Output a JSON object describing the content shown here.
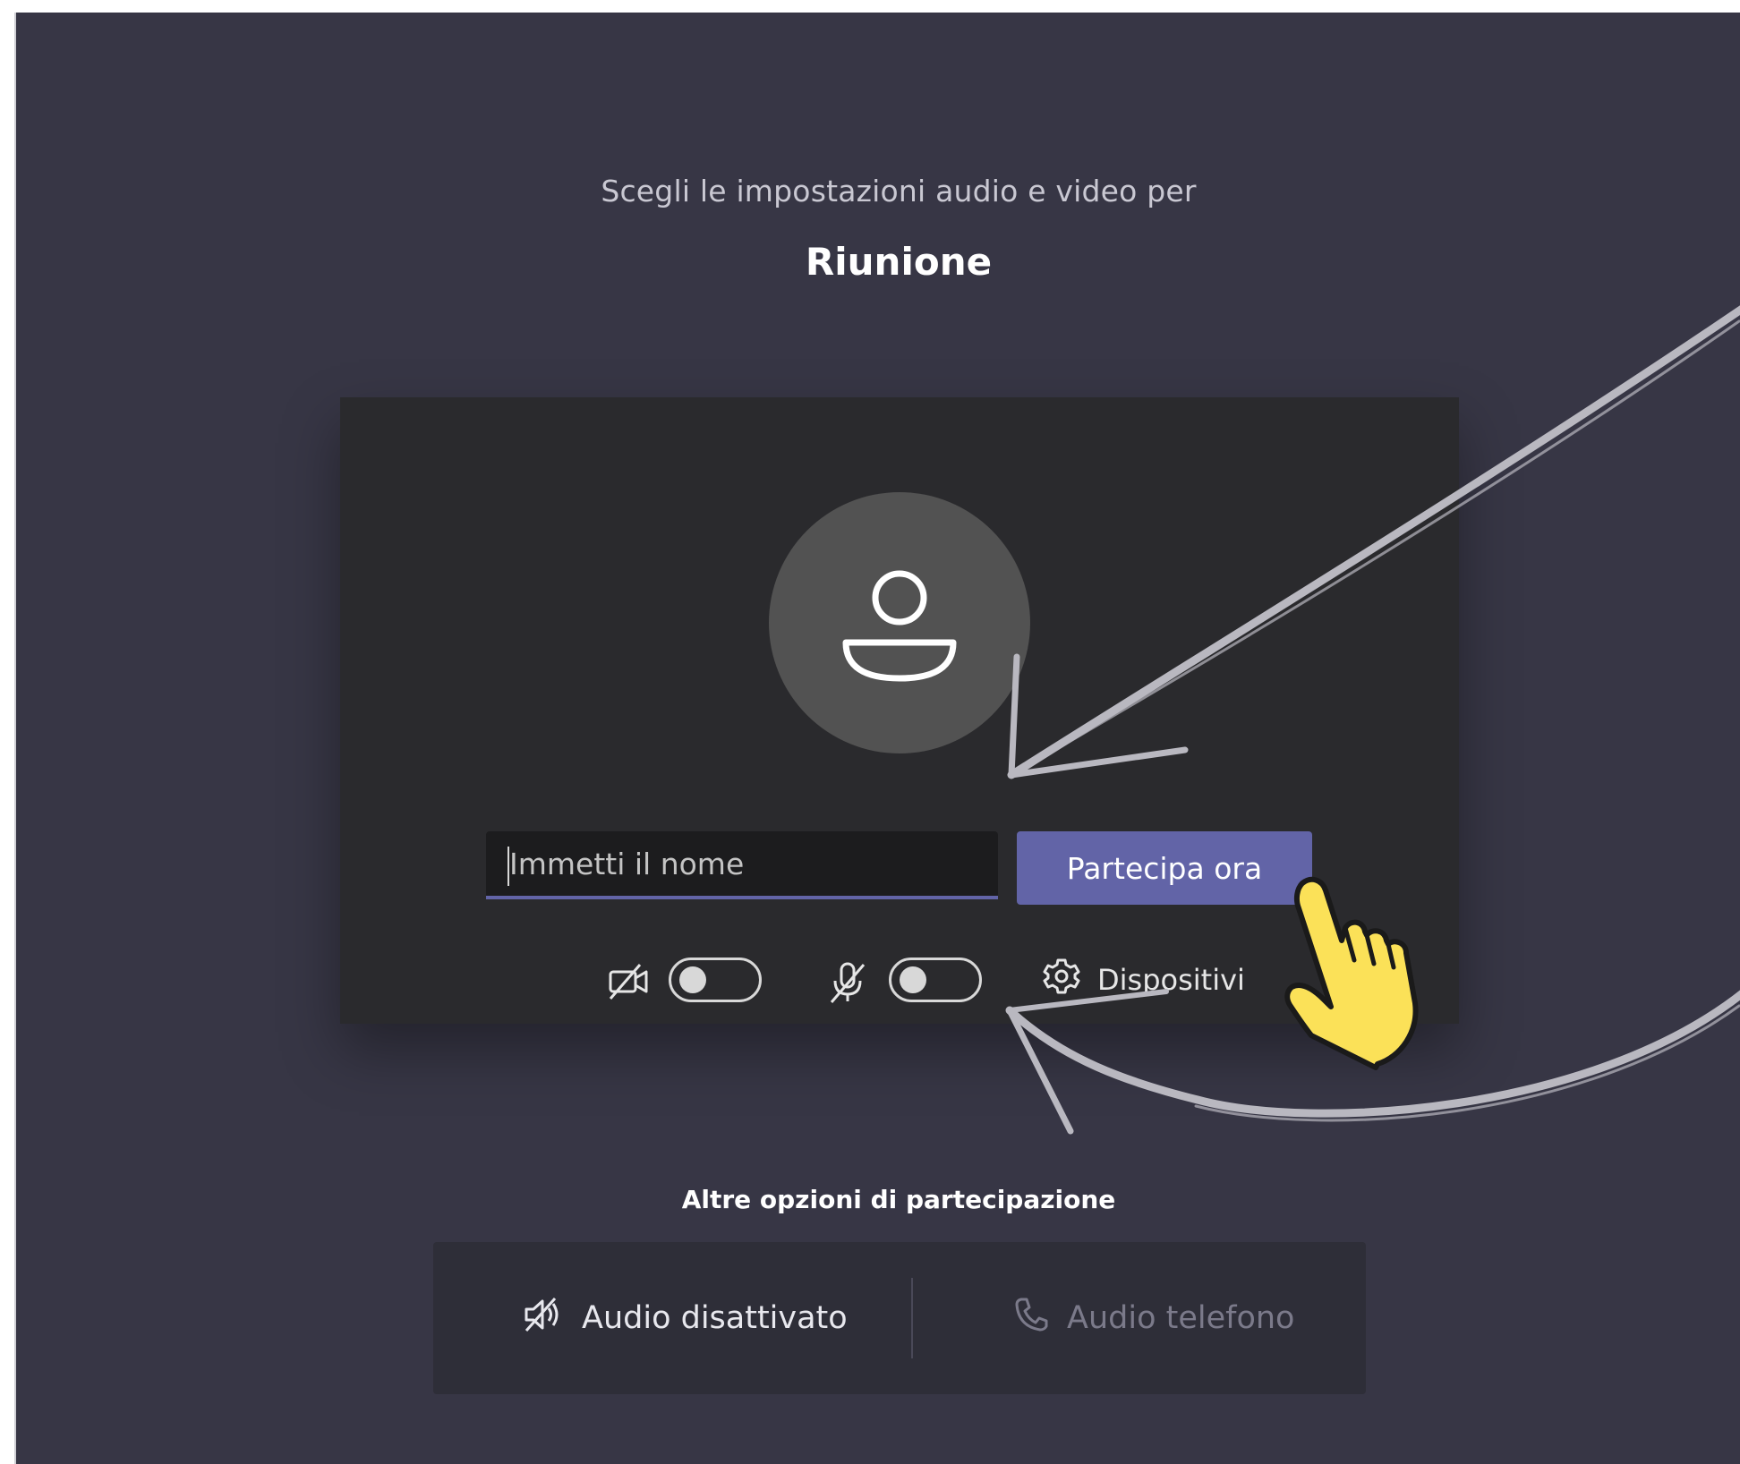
{
  "header": {
    "subtitle": "Scegli le impostazioni audio e video per",
    "meeting_title": "Riunione"
  },
  "prejoin": {
    "name_placeholder": "Immetti il nome",
    "join_label": "Partecipa ora",
    "camera_toggle": {
      "icon": "camera-off-icon",
      "state": "off"
    },
    "mic_toggle": {
      "icon": "mic-off-icon",
      "state": "off"
    },
    "devices_label": "Dispositivi",
    "devices_icon": "gear-icon"
  },
  "other_options": {
    "label": "Altre opzioni di partecipazione",
    "audio_off_label": "Audio disattivato",
    "audio_off_icon": "speaker-off-icon",
    "phone_audio_label": "Audio telefono",
    "phone_audio_icon": "phone-icon"
  },
  "colors": {
    "background": "#373645",
    "card": "#2a2a2d",
    "accent": "#6264a7",
    "hand_cursor": "#fbe158"
  }
}
